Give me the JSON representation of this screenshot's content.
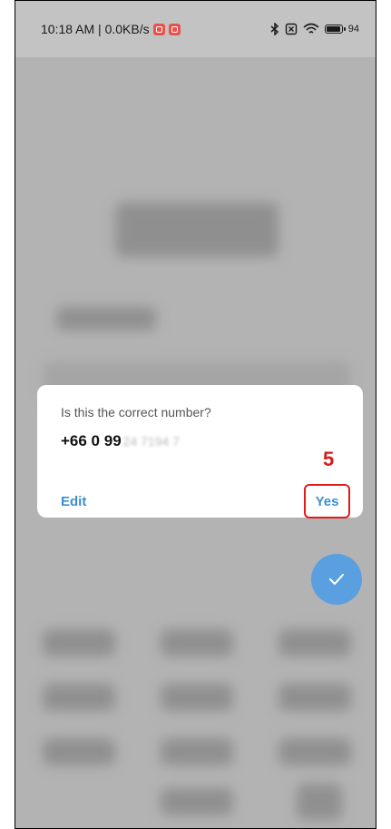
{
  "status_bar": {
    "time_speed": "10:18 AM | 0.0KB/s",
    "battery": "94"
  },
  "dialog": {
    "question": "Is this the correct number?",
    "number_prefix": "+66 0 99",
    "number_masked": "24 7194 7",
    "edit_label": "Edit",
    "yes_label": "Yes"
  },
  "annotation": {
    "step": "5",
    "color": "#e31a1a"
  },
  "fab": {
    "icon": "check-icon",
    "color": "#5a9fdf"
  }
}
